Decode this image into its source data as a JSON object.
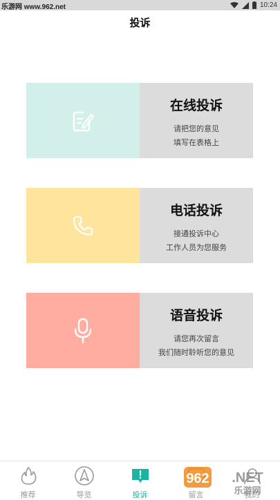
{
  "status_bar": {
    "left_text": "乐游网 www.962.net",
    "time": "10:24"
  },
  "page_title": "投诉",
  "cards": [
    {
      "title": "在线投诉",
      "line1": "请把您的意见",
      "line2": "填写在表格上",
      "icon": "edit-icon",
      "color": "#d3efea"
    },
    {
      "title": "电话投诉",
      "line1": "接通投诉中心",
      "line2": "工作人员为您服务",
      "icon": "phone-icon",
      "color": "#ffe49e"
    },
    {
      "title": "语音投诉",
      "line1": "请您再次留言",
      "line2": "我们随时聆听您的意见",
      "icon": "mic-icon",
      "color": "#ffaca1"
    }
  ],
  "tabs": [
    {
      "label": "推荐",
      "icon": "flame-icon"
    },
    {
      "label": "导览",
      "icon": "compass-icon"
    },
    {
      "label": "投诉",
      "icon": "complaint-icon",
      "active": true
    },
    {
      "label": "留言",
      "icon": "message-icon"
    },
    {
      "label": "我的",
      "icon": "user-icon"
    }
  ],
  "watermark": {
    "brand": "962",
    "suffix": ".NET",
    "text": "乐游网"
  },
  "colors": {
    "accent": "#1bb3a3",
    "panel_gray": "#dcdcdc"
  }
}
